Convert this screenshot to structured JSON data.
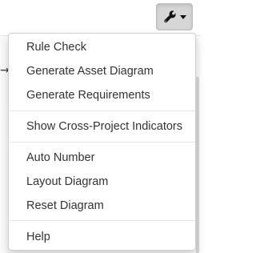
{
  "toolbar": {
    "tools_button_icon": "wrench-icon",
    "dropdown_icon": "caret-down-icon"
  },
  "background": {
    "arrow_glyph": "→"
  },
  "menu": {
    "group_analysis": [
      {
        "label": "Rule Check"
      },
      {
        "label": "Generate Asset Diagram"
      },
      {
        "label": "Generate Requirements"
      }
    ],
    "group_view": [
      {
        "label": "Show Cross-Project Indicators"
      }
    ],
    "group_diagram": [
      {
        "label": "Auto Number"
      },
      {
        "label": "Layout Diagram"
      },
      {
        "label": "Reset Diagram"
      }
    ],
    "group_help": [
      {
        "label": "Help"
      }
    ]
  }
}
